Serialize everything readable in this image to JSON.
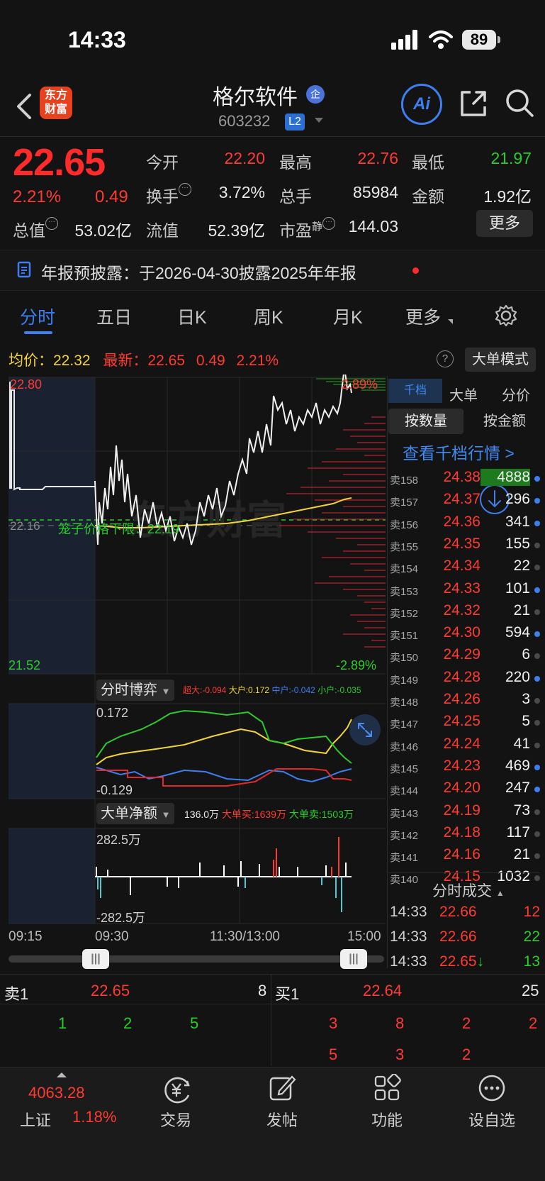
{
  "status_bar": {
    "time": "14:33",
    "battery": "89"
  },
  "header": {
    "logo_line1": "东方",
    "logo_line2": "财富",
    "stock_name": "格尔软件",
    "badge_qi": "企",
    "stock_code": "603232",
    "level_badge": "L2",
    "ai_label": "Ai"
  },
  "quote": {
    "price": "22.65",
    "change_pct": "2.21%",
    "change_amt": "0.49",
    "open_label": "今开",
    "open": "22.20",
    "high_label": "最高",
    "high": "22.76",
    "low_label": "最低",
    "low": "21.97",
    "turnover_label": "换手",
    "turnover": "3.72%",
    "volume_label": "总手",
    "volume": "85984",
    "amount_label": "金额",
    "amount": "1.92亿",
    "mktcap_label": "总值",
    "mktcap": "53.02亿",
    "float_label": "流值",
    "float_cap": "52.39亿",
    "pe_label": "市盈",
    "pe_sup": "静",
    "pe": "144.03",
    "more_label": "更多"
  },
  "notice": {
    "text": "年报预披露：于2026-04-30披露2025年年报"
  },
  "tabs": [
    "分时",
    "五日",
    "日K",
    "周K",
    "月K",
    "更多"
  ],
  "avg_row": {
    "avg_label": "均价：",
    "avg_value": "22.32",
    "latest_label": "最新：",
    "latest_value": "22.65",
    "latest_change": "0.49",
    "latest_pct": "2.21%",
    "help": "?",
    "mode_button": "大单模式"
  },
  "chart": {
    "y_max": "22.80",
    "y_min": "21.52",
    "y_mid": "22.16",
    "pct_max": "2.89%",
    "pct_min": "-2.89%",
    "cage_label": "笼子价格下限：22.19",
    "watermark": "东方财富",
    "x_labels": [
      "09:15",
      "09:30",
      "11:30/13:00",
      "15:00"
    ]
  },
  "game_chart": {
    "button": "分时博弈",
    "legend": [
      {
        "label": "超大:-0.094",
        "color": "#ff3b30"
      },
      {
        "label": "大户:0.172",
        "color": "#f2d43a"
      },
      {
        "label": "中户:-0.042",
        "color": "#3d7ef0"
      },
      {
        "label": "小户:-0.035",
        "color": "#2bcc2b"
      }
    ],
    "y_max": "0.172",
    "y_min": "-0.129"
  },
  "net_chart": {
    "button": "大单净额",
    "value": "136.0万",
    "buy_label": "大单买:1639万",
    "sell_label": "大单卖:1503万",
    "y_max": "282.5万",
    "y_min": "-282.5万"
  },
  "right_panel": {
    "tabs": [
      "千档",
      "大单",
      "分价"
    ],
    "btn_count": "按数量",
    "btn_amount": "按金额",
    "link": "查看千档行情 >",
    "orderbook": [
      {
        "label": "卖158",
        "price": "24.38",
        "vol": "4888",
        "dot": "b"
      },
      {
        "label": "卖157",
        "price": "24.37",
        "vol": "296",
        "dot": "b"
      },
      {
        "label": "卖156",
        "price": "24.36",
        "vol": "341",
        "dot": "b"
      },
      {
        "label": "卖155",
        "price": "24.35",
        "vol": "155",
        "dot": "g"
      },
      {
        "label": "卖154",
        "price": "24.34",
        "vol": "22",
        "dot": "g"
      },
      {
        "label": "卖153",
        "price": "24.33",
        "vol": "101",
        "dot": "b"
      },
      {
        "label": "卖152",
        "price": "24.32",
        "vol": "21",
        "dot": "g"
      },
      {
        "label": "卖151",
        "price": "24.30",
        "vol": "594",
        "dot": "b"
      },
      {
        "label": "卖150",
        "price": "24.29",
        "vol": "6",
        "dot": "g"
      },
      {
        "label": "卖149",
        "price": "24.28",
        "vol": "220",
        "dot": "b"
      },
      {
        "label": "卖148",
        "price": "24.26",
        "vol": "3",
        "dot": "g"
      },
      {
        "label": "卖147",
        "price": "24.25",
        "vol": "5",
        "dot": "g"
      },
      {
        "label": "卖146",
        "price": "24.24",
        "vol": "41",
        "dot": "g"
      },
      {
        "label": "卖145",
        "price": "24.23",
        "vol": "469",
        "dot": "b"
      },
      {
        "label": "卖144",
        "price": "24.20",
        "vol": "247",
        "dot": "b"
      },
      {
        "label": "卖143",
        "price": "24.19",
        "vol": "73",
        "dot": "g"
      },
      {
        "label": "卖142",
        "price": "24.18",
        "vol": "117",
        "dot": "g"
      },
      {
        "label": "卖141",
        "price": "24.16",
        "vol": "21",
        "dot": "g"
      },
      {
        "label": "卖140",
        "price": "24.15",
        "vol": "1032",
        "dot": "g"
      }
    ],
    "trades_title": "分时成交",
    "trades": [
      {
        "time": "14:33",
        "price": "22.66",
        "vol": "12",
        "color": "#ff3b30",
        "arrow": ""
      },
      {
        "time": "14:33",
        "price": "22.66",
        "vol": "22",
        "color": "#2bcc2b",
        "arrow": ""
      },
      {
        "time": "14:33",
        "price": "22.65",
        "vol": "13",
        "color": "#2bcc2b",
        "arrow": "↓"
      }
    ]
  },
  "level1": {
    "sell1_label": "卖1",
    "sell1_price": "22.65",
    "sell1_vol": "8",
    "buy1_label": "买1",
    "buy1_price": "22.64",
    "buy1_vol": "25",
    "sell_queue": [
      "1",
      "2",
      "5"
    ],
    "buy_queue_row1": [
      "3",
      "8",
      "2",
      "2"
    ],
    "buy_queue_row2": [
      "5",
      "3",
      "2"
    ]
  },
  "bottom_bar": {
    "index_value": "4063.28",
    "index_name": "上证",
    "index_pct": "1.18%",
    "items": [
      "交易",
      "发帖",
      "功能",
      "设自选"
    ]
  }
}
